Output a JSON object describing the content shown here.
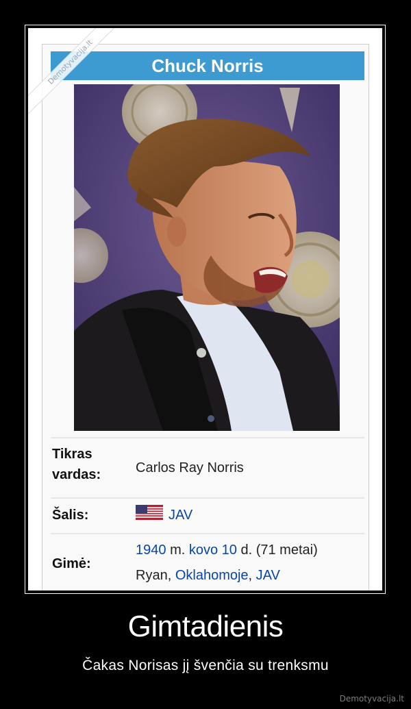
{
  "watermark_ribbon": "Demotyvacija.lt",
  "infobox": {
    "title": "Chuck Norris",
    "rows": [
      {
        "label_line1": "Tikras",
        "label_line2": "vardas:",
        "value": "Carlos Ray Norris"
      },
      {
        "label": "Šalis:",
        "flag": "us-flag-icon",
        "value_link": "JAV"
      },
      {
        "label": "Gimė:",
        "line1": {
          "year": "1940",
          "m": "m.",
          "month": "kovo 10",
          "d": "d.",
          "age": "(71 metai)"
        },
        "line2": {
          "city": "Ryan",
          "sep1": ",",
          "state": "Oklahomoje",
          "sep2": ",",
          "country": "JAV"
        }
      }
    ]
  },
  "caption": {
    "title": "Gimtadienis",
    "subtitle": "Čakas Norisas jį švenčia su trenksmu"
  },
  "site_watermark": "Demotyvacija.lt",
  "colors": {
    "background": "#000000",
    "title_bar": "#3d9bd1",
    "link": "#0645ad"
  }
}
